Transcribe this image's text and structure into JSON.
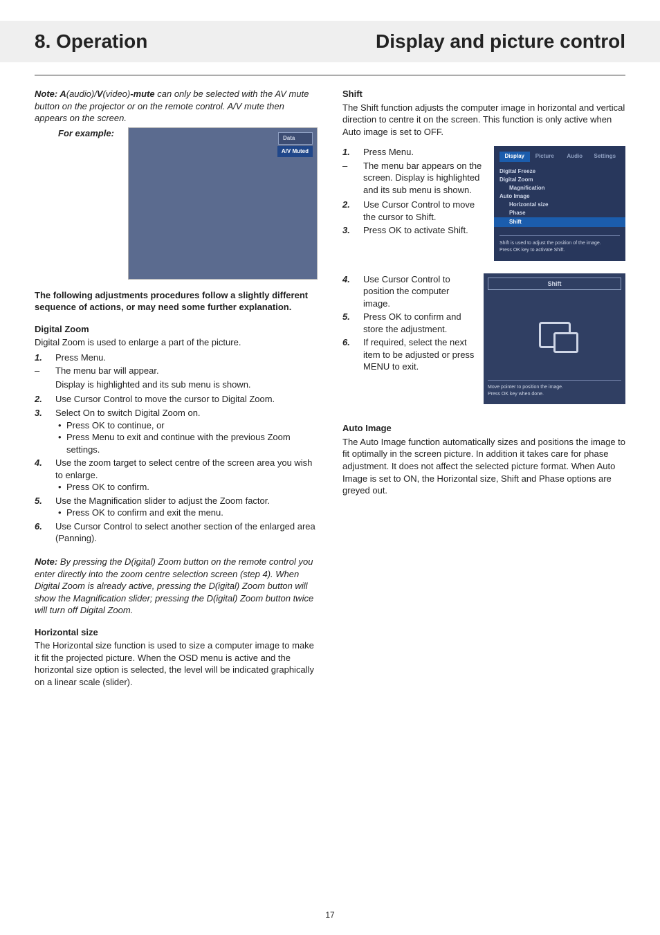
{
  "header": {
    "left": "8. Operation",
    "right": "Display and picture control"
  },
  "page_number": "17",
  "note1": {
    "prefix": "Note: ",
    "a": "A",
    "audio": "(audio)/",
    "v": "V",
    "video": "(video)",
    "mute": "-mute",
    "rest1": " can only be selected with the AV mute button on the projector or on the remote control. A/V mute then appears on the screen.",
    "example": "For example:"
  },
  "avbox": {
    "data": "Data",
    "muted": "A/V Muted"
  },
  "transition": "The following adjustments procedures follow a slightly different sequence of actions, or may need some further explanation.",
  "dz": {
    "title": "Digital Zoom",
    "intro": "Digital Zoom is used to enlarge a part of the picture.",
    "s1": "Press Menu.",
    "s1a": "The menu bar will appear.",
    "s1b": "Display is highlighted and its sub menu is shown.",
    "s2": "Use Cursor Control to move the cursor to Digital Zoom.",
    "s3": "Select On to switch Digital Zoom on.",
    "s3a": "Press OK to continue, or",
    "s3b": "Press Menu to exit and continue with the previous Zoom settings.",
    "s4": "Use the zoom target to select centre of the screen area you wish to enlarge.",
    "s4a": "Press OK to confirm.",
    "s5": "Use the Magnification slider to adjust the Zoom factor.",
    "s5a": "Press OK to confirm and exit the menu.",
    "s6": "Use Cursor Control to select another section of the enlarged area (Panning)."
  },
  "note2": {
    "prefix": "Note: ",
    "body": "By pressing the D(igital) Zoom button on the remote control you enter directly into the zoom centre selection screen (step 4). When Digital Zoom is already active, pressing the D(igital) Zoom button will show the Magnification slider; pressing the D(igital) Zoom button twice will turn off Digital Zoom."
  },
  "hs": {
    "title": "Horizontal size",
    "body": "The Horizontal size function is used to size a computer image to make it fit the projected picture. When the OSD menu is active and the horizontal size option is selected, the level will be indicated graphically on a linear scale (slider)."
  },
  "shift": {
    "title": "Shift",
    "intro": "The Shift function adjusts the computer image in horizontal and vertical direction to centre it on the screen. This function is only active when Auto image is set to OFF.",
    "s1": "Press Menu.",
    "s1a": "The menu bar appears on the screen. Display is highlighted and its sub menu is shown.",
    "s2": "Use Cursor Control to move the cursor to Shift.",
    "s3": "Press OK to activate Shift.",
    "s4": "Use Cursor Control to position the computer image.",
    "s5": "Press OK to confirm and store the adjustment.",
    "s6": "If required, select the next item to be adjusted or press MENU to exit."
  },
  "osd": {
    "tabs": {
      "display": "Display",
      "picture": "Picture",
      "audio": "Audio",
      "settings": "Settings"
    },
    "items": {
      "freeze": "Digital Freeze",
      "zoom": "Digital Zoom",
      "mag": "Magnification",
      "auto": "Auto Image",
      "hsize": "Horizontal size",
      "phase": "Phase",
      "shift": "Shift"
    },
    "help1": "Shift is used to adjust the position of the image.",
    "help2": "Press OK key to activate Shift."
  },
  "shiftpanel": {
    "title": "Shift",
    "help1": "Move pointer to position the image.",
    "help2": "Press OK key when done."
  },
  "ai": {
    "title": "Auto Image",
    "body": "The Auto Image function automatically sizes and positions the image to fit optimally in the screen picture. In addition it takes care for phase adjustment. It does not affect the selected picture format. When Auto Image is set to ON, the Horizontal size, Shift and Phase options are greyed out."
  }
}
